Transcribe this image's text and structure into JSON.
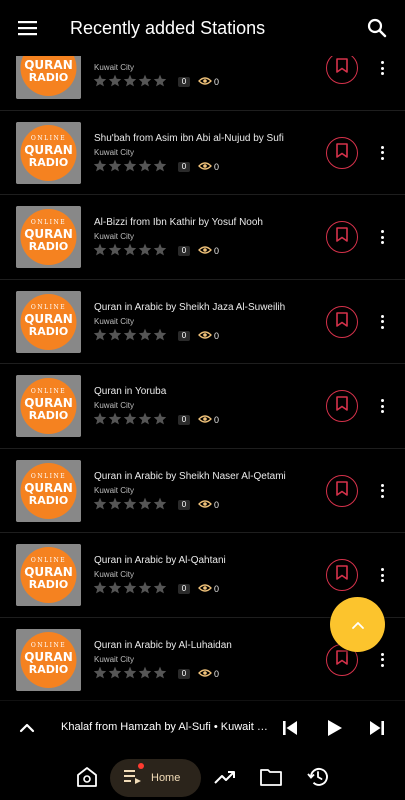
{
  "header": {
    "title": "Recently added Stations",
    "menu_icon": "menu-icon",
    "search_icon": "search-icon"
  },
  "thumbnail": {
    "line1": "ONLINE",
    "line2": "QURAN",
    "line3": "RADIO",
    "accent": "#f58220"
  },
  "stations": [
    {
      "title": "",
      "city": "Kuwait City",
      "rating_count": "0",
      "views": "0"
    },
    {
      "title": "Shu'bah from Asim ibn Abi al-Nujud by Sufi",
      "city": "Kuwait City",
      "rating_count": "0",
      "views": "0"
    },
    {
      "title": "Al-Bizzi from Ibn Kathir by Yosuf Nooh",
      "city": "Kuwait City",
      "rating_count": "0",
      "views": "0"
    },
    {
      "title": "Quran in Arabic by Sheikh Jaza Al-Suweilih",
      "city": "Kuwait City",
      "rating_count": "0",
      "views": "0"
    },
    {
      "title": "Quran in Yoruba",
      "city": "Kuwait City",
      "rating_count": "0",
      "views": "0"
    },
    {
      "title": "Quran in Arabic by Sheikh Naser Al-Qetami",
      "city": "Kuwait City",
      "rating_count": "0",
      "views": "0"
    },
    {
      "title": "Quran in Arabic by Al-Qahtani",
      "city": "Kuwait City",
      "rating_count": "0",
      "views": "0"
    },
    {
      "title": "Quran in Arabic by Al-Luhaidan",
      "city": "Kuwait City",
      "rating_count": "0",
      "views": "0"
    }
  ],
  "player": {
    "now_playing": "Khalaf from Hamzah by Al-Sufi • Kuwait City"
  },
  "nav": {
    "home_label": "Home"
  },
  "colors": {
    "background": "#000000",
    "bookmark": "#d6324b",
    "fab": "#fcc42d",
    "home_pill": "#2b241b"
  }
}
